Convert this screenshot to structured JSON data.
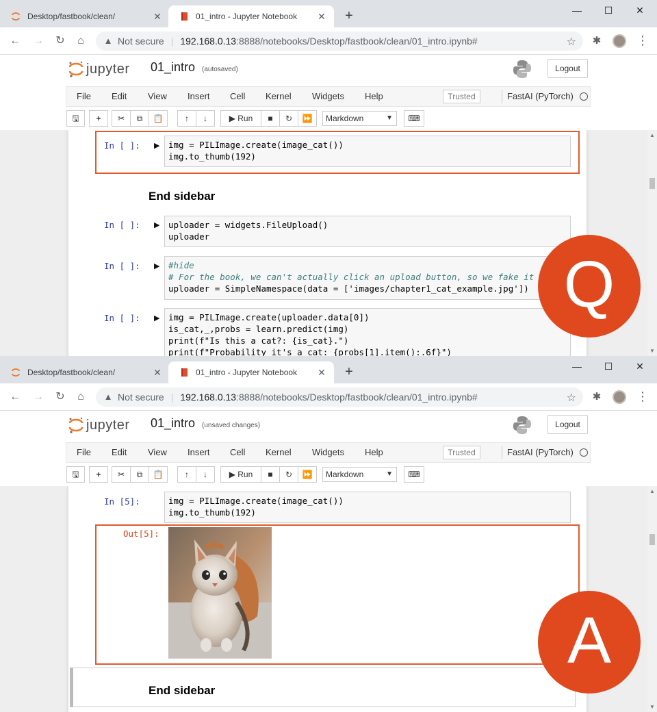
{
  "browser": {
    "inactive_tab": "Desktop/fastbook/clean/",
    "active_tab": "01_intro - Jupyter Notebook",
    "new_tab": "+",
    "not_secure": "Not secure",
    "url_host": "192.168.0.13",
    "url_rest": ":8888/notebooks/Desktop/fastbook/clean/01_intro.ipynb#"
  },
  "jupyter": {
    "logo_text": "jupyter",
    "notebook_name": "01_intro",
    "logout": "Logout",
    "menu": [
      "File",
      "Edit",
      "View",
      "Insert",
      "Cell",
      "Kernel",
      "Widgets",
      "Help"
    ],
    "trusted": "Trusted",
    "kernel": "FastAI (PyTorch)",
    "run": "Run",
    "cell_type": "Markdown"
  },
  "panel_q": {
    "save_state": "(autosaved)",
    "badge": "Q",
    "cells": [
      {
        "prompt": "In [ ]:",
        "lines": [
          "img = PILImage.create(image_cat())",
          "img.to_thumb(192)"
        ]
      },
      {
        "prompt": "In [ ]:",
        "lines": [
          "uploader = widgets.FileUpload()",
          "uploader"
        ]
      },
      {
        "prompt": "In [ ]:",
        "lines": [
          "#hide",
          "# For the book, we can't actually click an upload button, so we fake it",
          "uploader = SimpleNamespace(data = ['images/chapter1_cat_example.jpg'])"
        ]
      },
      {
        "prompt": "In [ ]:",
        "lines": [
          "img = PILImage.create(uploader.data[0])",
          "is_cat,_,probs = learn.predict(img)",
          "print(f\"Is this a cat?: {is_cat}.\")",
          "print(f\"Probability it's a cat: {probs[1].item():.6f}\")"
        ]
      }
    ],
    "sidebar_heading": "End sidebar"
  },
  "panel_a": {
    "save_state": "(unsaved changes)",
    "badge": "A",
    "cell": {
      "prompt": "In [5]:",
      "lines": [
        "img = PILImage.create(image_cat())",
        "img.to_thumb(192)"
      ]
    },
    "out_prompt": "Out[5]:",
    "sidebar_heading": "End sidebar"
  },
  "colors": {
    "highlight": "#e05a2b",
    "badge": "#e0481e",
    "in_prompt": "#303f9f",
    "out_prompt": "#d84315"
  }
}
